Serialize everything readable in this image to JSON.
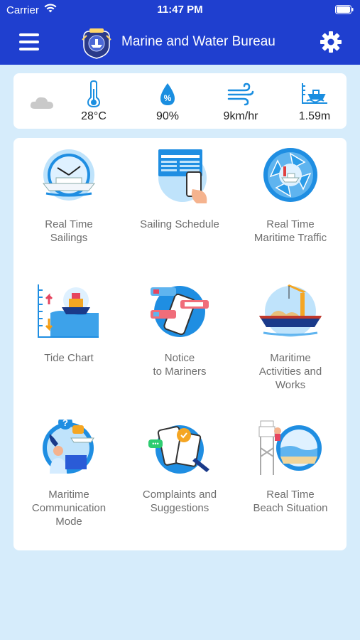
{
  "status_bar": {
    "carrier": "Carrier",
    "time": "11:47 PM"
  },
  "header": {
    "title": "Marine and Water Bureau",
    "menu_icon": "hamburger-menu-icon",
    "settings_icon": "gear-icon",
    "logo_icon": "bureau-emblem-logo"
  },
  "weather": {
    "condition_icon": "cloud-icon",
    "temperature": "28°C",
    "humidity": "90%",
    "wind": "9km/hr",
    "wave_height": "1.59m"
  },
  "tiles": [
    {
      "label": "Real Time\nSailings",
      "icon": "ferry-clock-icon"
    },
    {
      "label": "Sailing Schedule",
      "icon": "schedule-phone-icon"
    },
    {
      "label": "Real Time\nMaritime Traffic",
      "icon": "camera-shutter-ship-icon"
    },
    {
      "label": "Tide Chart",
      "icon": "tide-boat-icon"
    },
    {
      "label": "Notice\nto Mariners",
      "icon": "notice-phone-icon"
    },
    {
      "label": "Maritime\nActivities and\nWorks",
      "icon": "crane-barge-icon"
    },
    {
      "label": "Maritime\nCommunication\nMode",
      "icon": "operator-phone-icon"
    },
    {
      "label": "Complaints and\nSuggestions",
      "icon": "complaint-chat-icon"
    },
    {
      "label": "Real Time\nBeach Situation",
      "icon": "lifeguard-beach-icon"
    }
  ],
  "colors": {
    "header_bg": "#1f3fcf",
    "page_bg": "#d6ecfb",
    "icon_blue": "#1a8ee0"
  }
}
